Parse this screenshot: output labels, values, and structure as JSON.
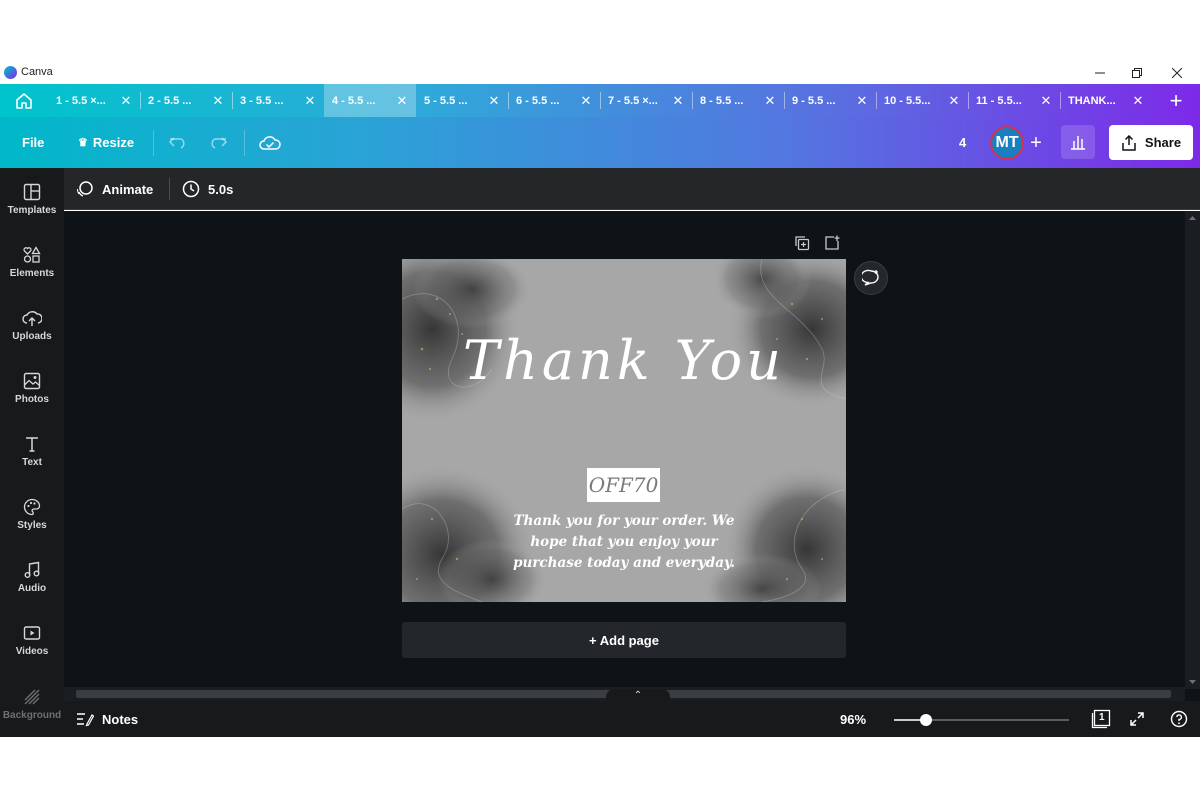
{
  "window": {
    "title": "Canva"
  },
  "tabs": [
    {
      "label": "1 - 5.5 ×...",
      "active": false
    },
    {
      "label": "2 - 5.5 ...",
      "active": false
    },
    {
      "label": "3 - 5.5 ...",
      "active": false
    },
    {
      "label": "4 - 5.5 ...",
      "active": true
    },
    {
      "label": "5 - 5.5 ...",
      "active": false
    },
    {
      "label": "6 - 5.5 ...",
      "active": false
    },
    {
      "label": "7 - 5.5 ×...",
      "active": false
    },
    {
      "label": "8 - 5.5 ...",
      "active": false
    },
    {
      "label": "9 - 5.5 ...",
      "active": false
    },
    {
      "label": "10 - 5.5...",
      "active": false
    },
    {
      "label": "11 - 5.5...",
      "active": false
    },
    {
      "label": "THANK...",
      "active": false
    }
  ],
  "toolbar": {
    "file_label": "File",
    "resize_label": "Resize",
    "collaborator_count": "4",
    "avatar_initials": "MT",
    "share_label": "Share"
  },
  "sidebar": {
    "items": [
      {
        "label": "Templates",
        "icon": "templates-icon"
      },
      {
        "label": "Elements",
        "icon": "elements-icon"
      },
      {
        "label": "Uploads",
        "icon": "uploads-icon"
      },
      {
        "label": "Photos",
        "icon": "photos-icon"
      },
      {
        "label": "Text",
        "icon": "text-icon"
      },
      {
        "label": "Styles",
        "icon": "styles-icon"
      },
      {
        "label": "Audio",
        "icon": "audio-icon"
      },
      {
        "label": "Videos",
        "icon": "videos-icon"
      },
      {
        "label": "Background",
        "icon": "background-icon"
      }
    ]
  },
  "context": {
    "animate_label": "Animate",
    "duration": "5.0s"
  },
  "design": {
    "heading": "Thank You",
    "coupon_code": "OFF70",
    "message": "Thank you for your order. We hope that you enjoy your purchase today and everyday."
  },
  "canvas": {
    "add_page_label": "+ Add page"
  },
  "bottom": {
    "notes_label": "Notes",
    "zoom": "96%",
    "zoom_fraction": 0.18,
    "page_count": "1"
  },
  "colors": {
    "accent_start": "#00c4cc",
    "accent_end": "#7d2ae8",
    "canvas_bg": "#0e1318",
    "page_bg": "#a7a7a7"
  }
}
